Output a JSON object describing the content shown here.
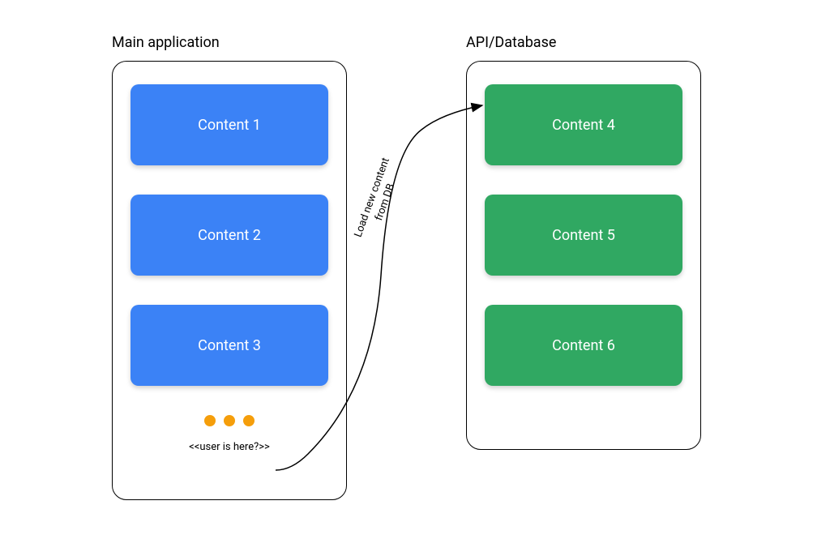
{
  "labels": {
    "left": "Main application",
    "right": "API/Database"
  },
  "left_panel": {
    "blocks": [
      "Content 1",
      "Content 2",
      "Content 3"
    ],
    "user_position": "<<user is here?>>"
  },
  "right_panel": {
    "blocks": [
      "Content 4",
      "Content 5",
      "Content 6"
    ]
  },
  "connector": {
    "label_line1": "Load new content",
    "label_line2": "from DB"
  },
  "colors": {
    "blue": "#3B82F6",
    "green": "#30A862",
    "orange": "#F59E0B"
  }
}
